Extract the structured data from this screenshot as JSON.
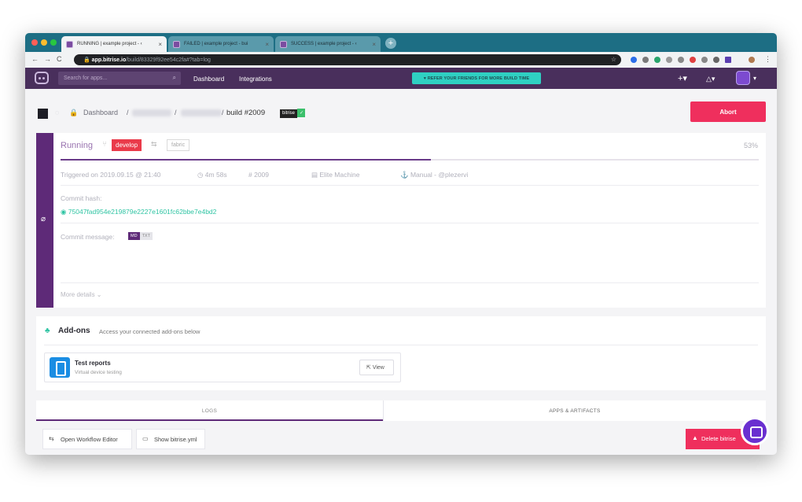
{
  "browser": {
    "tabs": [
      {
        "title": "RUNNING | example project - ‹"
      },
      {
        "title": "FAILED | example project - bui"
      },
      {
        "title": "SUCCESS | example project - ‹"
      }
    ],
    "close_glyph": "×",
    "new_tab_glyph": "+",
    "url_domain": "app.bitrise.io",
    "url_path": "/build/83329f92ee54c2fa#?tab=log",
    "star_glyph": "☆"
  },
  "app": {
    "search_placeholder": "Search for apps...",
    "nav": [
      "Dashboard",
      "Integrations"
    ],
    "refer_banner": "♥ REFER YOUR FRIENDS FOR MORE BUILD TIME",
    "plus_icon": "+▾",
    "bell_icon": "△▾",
    "avatar_caret": "▾"
  },
  "breadcrumb": {
    "dashboard": "Dashboard",
    "sep": "/",
    "build": "build #2009",
    "badge": "bitrise",
    "check": "✓"
  },
  "actions": {
    "abort": "Abort"
  },
  "build": {
    "status": "Running",
    "branch": "develop",
    "tag": "fabric",
    "progress_percent": 53,
    "progress_label": "53%",
    "triggered": "Triggered on 2019.09.15 @ 21:40",
    "duration": "◷ 4m 58s",
    "number": "# 2009",
    "machine": "▤ Elite Machine",
    "trigger_by": "⚓ Manual - @plezervi",
    "commit_hash_label": "Commit hash:",
    "commit_hash": "75047fad954e219879e2227e1601fc62bbe7e4bd2",
    "commit_message_label": "Commit message:",
    "md": "MD",
    "txt": "TXT",
    "more_details": "More details ⌄"
  },
  "addons": {
    "title": "Add-ons",
    "subtitle": "Access your connected add-ons below",
    "items": [
      {
        "name": "Test reports",
        "description": "Virtual device testing",
        "view": "View"
      }
    ]
  },
  "tabs": [
    "LOGS",
    "APPS & ARTIFACTS"
  ],
  "toolbar": {
    "open_workflow": "Open Workflow Editor",
    "show_yml": "Show bitrise.yml",
    "delete": "Delete bitrise"
  },
  "colors": {
    "brand_purple": "#492f5c",
    "accent_red": "#ef2f5d",
    "teal": "#2fd0c2"
  }
}
